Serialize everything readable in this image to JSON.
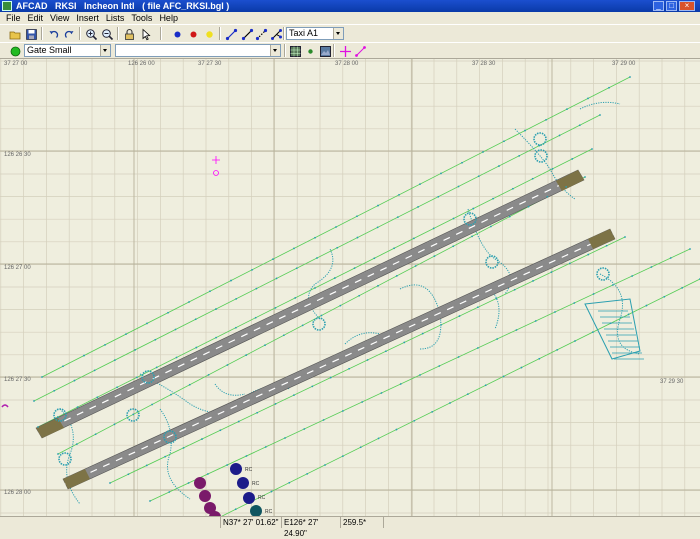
{
  "window": {
    "app_name": "AFCAD",
    "airport_code": "RKSI",
    "airport_name": "Incheon Intl",
    "file_info": "( file AFC_RKSI.bgl )"
  },
  "menu": [
    "File",
    "Edit",
    "View",
    "Insert",
    "Lists",
    "Tools",
    "Help"
  ],
  "toolbar": {
    "taxi_type_value": "Taxi A1",
    "icons": [
      "open-icon",
      "save-icon",
      "undo-icon",
      "redo-icon",
      "zoom-in-icon",
      "zoom-out-icon",
      "lock-icon",
      "select-arrow-icon",
      "blue-node-icon",
      "red-node-icon",
      "yellow-node-icon",
      "link-icon",
      "link-blue-icon",
      "link-dotted-icon",
      "link-split-icon"
    ]
  },
  "toolbar2": {
    "status_color": "#22bb22",
    "parking_type_value": "Gate Small",
    "second_combo_value": "",
    "icons": [
      "grid-icon",
      "center-icon",
      "background-icon",
      "crosshair-icon",
      "measure-icon"
    ]
  },
  "map": {
    "top_coords": [
      "37 27 00",
      "126 26 00",
      "37 27 30",
      "37 28 00",
      "37 28 30",
      "37 29 00"
    ],
    "left_coords": [
      "126 26 30",
      "126 27 00",
      "126 27 30",
      "126 28 00"
    ],
    "right_coords": [
      "37 29 30"
    ],
    "parking_labels": [
      "RC",
      "RC",
      "RC",
      "RC"
    ],
    "colors": {
      "background": "#efeede",
      "grid": "#d4cfbc",
      "runway": "#8a8a8a",
      "taxi_path": "#55cc55",
      "taxi_node": "#2a9fb0",
      "parking": "#7a1a6a",
      "parking_blue": "#1c1c8a",
      "marker": "#ff00ff"
    }
  },
  "status": {
    "lat": "N37* 27' 01.62\"",
    "lon": "E126* 27' 24.90\"",
    "heading": "259.5*"
  }
}
